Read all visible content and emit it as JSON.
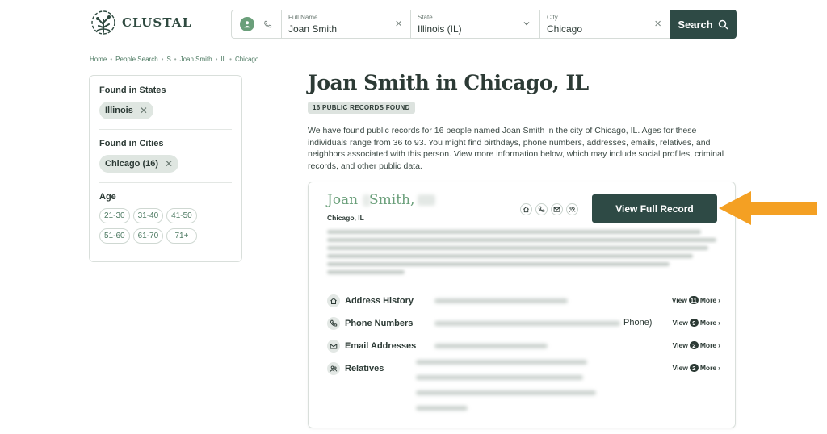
{
  "brand": {
    "name": "CLUSTAL"
  },
  "search": {
    "full_name_label": "Full Name",
    "full_name_value": "Joan Smith",
    "state_label": "State",
    "state_value": "Illinois (IL)",
    "city_label": "City",
    "city_value": "Chicago",
    "button_label": "Search"
  },
  "breadcrumb": [
    "Home",
    "People Search",
    "S",
    "Joan Smith",
    "IL",
    "Chicago"
  ],
  "filters": {
    "states_title": "Found in States",
    "state_chip": "Illinois",
    "cities_title": "Found in Cities",
    "city_chip": "Chicago (16)",
    "age_title": "Age",
    "age_ranges": [
      "21-30",
      "31-40",
      "41-50",
      "51-60",
      "61-70",
      "71+"
    ]
  },
  "main": {
    "title": "Joan Smith in Chicago, IL",
    "badge": "16 PUBLIC RECORDS FOUND",
    "intro": "We have found public records for 16 people named Joan Smith in the city of Chicago, IL. Ages for these individuals range from 36 to 93. You might find birthdays, phone numbers, addresses, emails, relatives, and neighbors associated with this person. View more information below, which may include social profiles, criminal records, and other public data."
  },
  "card": {
    "first_name": "Joan",
    "last_name": "Smith,",
    "location": "Chicago, IL",
    "view_button": "View Full Record",
    "rows": [
      {
        "label": "Address History",
        "icon": "home-icon",
        "count": "11",
        "suffix": ""
      },
      {
        "label": "Phone Numbers",
        "icon": "phone-icon",
        "count": "9",
        "suffix": "Phone)"
      },
      {
        "label": "Email Addresses",
        "icon": "email-icon",
        "count": "2",
        "suffix": ""
      },
      {
        "label": "Relatives",
        "icon": "relatives-icon",
        "count": "2",
        "suffix": ""
      }
    ],
    "view_word": "View",
    "more_word": "More"
  },
  "colors": {
    "primary_dark": "#2e4a45",
    "accent_green": "#6a9f7a",
    "arrow_orange": "#f4a023"
  }
}
